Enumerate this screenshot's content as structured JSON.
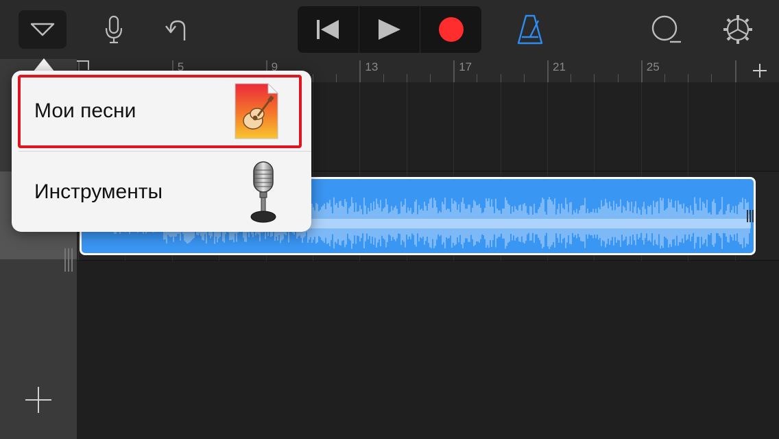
{
  "toolbar": {
    "menu_icon": "triangle-down-icon",
    "mic_icon": "microphone-icon",
    "undo_icon": "undo-icon",
    "rewind_icon": "rewind-icon",
    "play_icon": "play-icon",
    "record_icon": "record-icon",
    "metronome_icon": "metronome-icon",
    "loop_icon": "loop-icon",
    "settings_icon": "gear-icon",
    "colors": {
      "record": "#ff2d2d",
      "metronome": "#2f8cf0"
    }
  },
  "ruler": {
    "labels": [
      "5",
      "9",
      "13",
      "17",
      "21",
      "25"
    ]
  },
  "menu": {
    "items": [
      {
        "label": "Мои песни",
        "icon": "garageband-document-icon",
        "highlighted": true
      },
      {
        "label": "Инструменты",
        "icon": "microphone-instrument-icon",
        "highlighted": false
      }
    ],
    "highlight_color": "#e0141e"
  },
  "region": {
    "color": "#3a96f3"
  }
}
